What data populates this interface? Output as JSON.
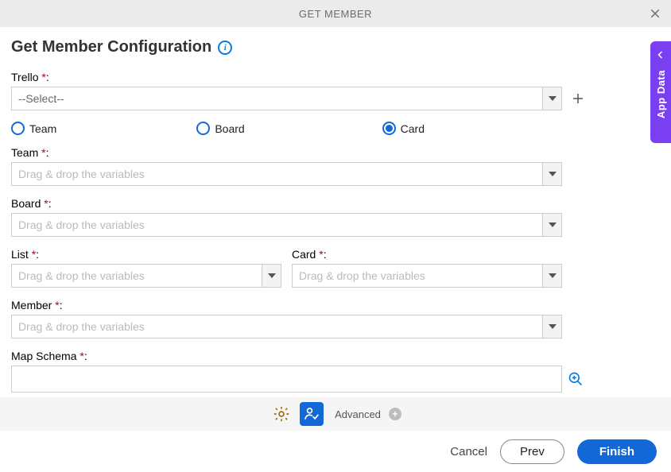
{
  "header": {
    "title": "GET MEMBER"
  },
  "page_title": "Get Member Configuration",
  "trello": {
    "label": "Trello",
    "selected": "--Select--"
  },
  "radios": {
    "team": "Team",
    "board": "Board",
    "card": "Card",
    "selected": "card"
  },
  "fields": {
    "team": {
      "label": "Team",
      "placeholder": "Drag & drop the variables"
    },
    "board": {
      "label": "Board",
      "placeholder": "Drag & drop the variables"
    },
    "list": {
      "label": "List",
      "placeholder": "Drag & drop the variables"
    },
    "card": {
      "label": "Card",
      "placeholder": "Drag & drop the variables"
    },
    "member": {
      "label": "Member",
      "placeholder": "Drag & drop the variables"
    },
    "mapschema": {
      "label": "Map Schema"
    }
  },
  "toolbar": {
    "advanced": "Advanced"
  },
  "footer": {
    "cancel": "Cancel",
    "prev": "Prev",
    "finish": "Finish"
  },
  "sidetab": {
    "label": "App Data"
  }
}
